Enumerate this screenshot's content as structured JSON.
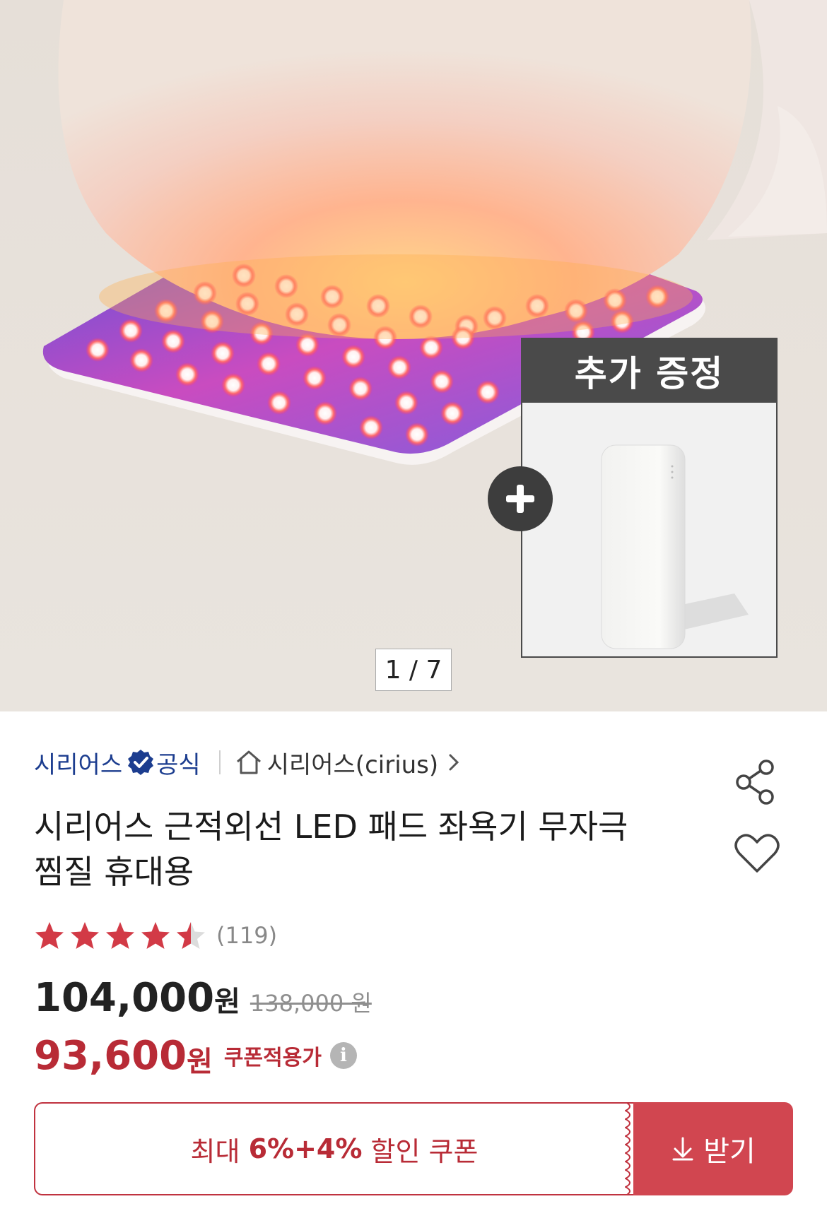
{
  "hero": {
    "gift_badge": "추가 증정",
    "counter": "1 / 7"
  },
  "brand": {
    "name": "시리어스",
    "official": "공식",
    "store": "시리어스(cirius)",
    "accent": "#1c3d8f"
  },
  "product": {
    "title_line1": "시리어스 근적외선 LED 패드 좌욕기 무자극",
    "title_line2": "찜질 휴대용",
    "rating": 4.5,
    "rating_max": 5,
    "review_count": "(119)",
    "price": "104,000",
    "price_unit": "원",
    "original_price": "138,000 원",
    "coupon_price": "93,600",
    "coupon_price_unit": "원",
    "coupon_label": "쿠폰적용가",
    "price_color": "#b82b36"
  },
  "coupon": {
    "prefix": "최대 ",
    "pct1": "6%",
    "plus": " + ",
    "pct2": "4%",
    "suffix": " 할인 쿠폰",
    "button": "받기"
  },
  "icons": [
    "verified-badge-icon",
    "home-icon",
    "chevron-right-icon",
    "share-icon",
    "heart-icon",
    "star-icon",
    "info-icon",
    "plus-icon",
    "download-icon"
  ]
}
